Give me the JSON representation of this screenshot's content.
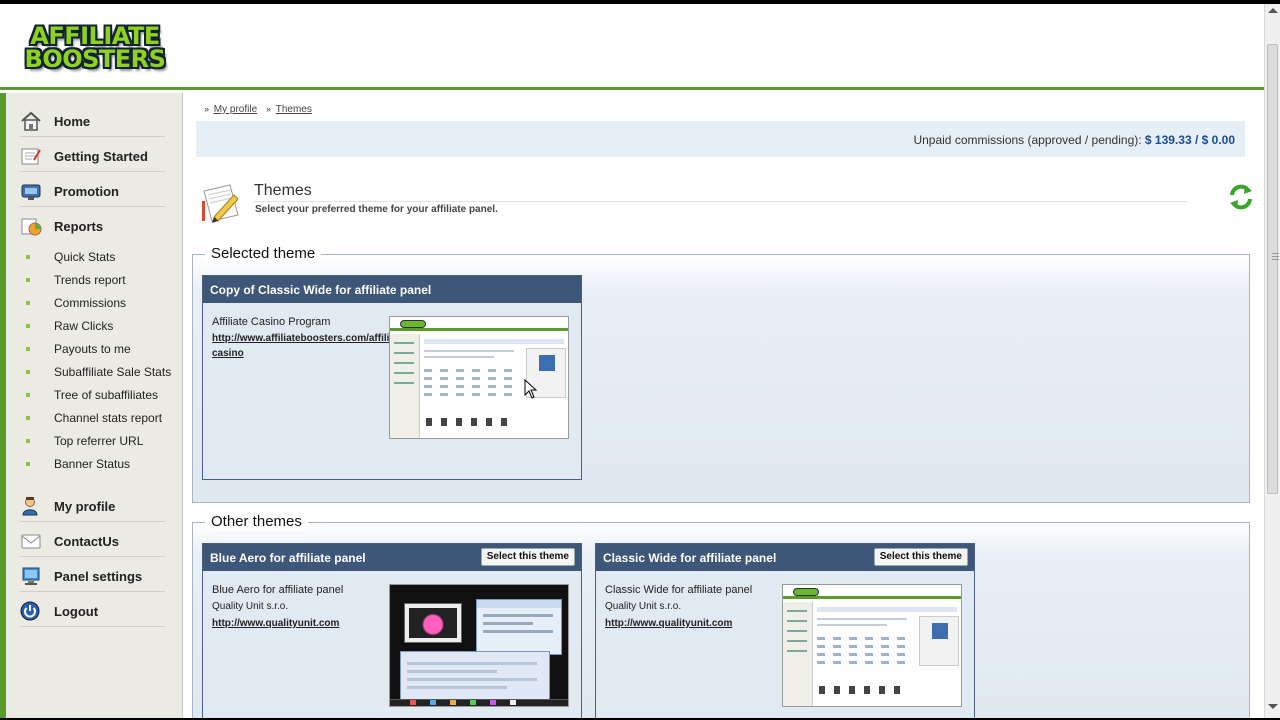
{
  "logo": {
    "line1": "AFFILIATE",
    "line2": "BOOSTERS"
  },
  "sidebar": {
    "main": [
      {
        "label": "Home",
        "icon": "home-icon"
      },
      {
        "label": "Getting Started",
        "icon": "getting-started-icon"
      },
      {
        "label": "Promotion",
        "icon": "promotion-icon"
      },
      {
        "label": "Reports",
        "icon": "reports-icon"
      }
    ],
    "reports_sub": [
      "Quick Stats",
      "Trends report",
      "Commissions",
      "Raw Clicks",
      "Payouts to me",
      "Subaffiliate Sale Stats",
      "Tree of subaffiliates",
      "Channel stats report",
      "Top referrer URL",
      "Banner Status"
    ],
    "bottom": [
      {
        "label": "My profile",
        "icon": "user-icon"
      },
      {
        "label": "ContactUs",
        "icon": "contact-icon"
      },
      {
        "label": "Panel settings",
        "icon": "monitor-icon"
      },
      {
        "label": "Logout",
        "icon": "power-icon"
      }
    ]
  },
  "breadcrumb": {
    "sep": "»",
    "items": [
      "My profile",
      "Themes"
    ]
  },
  "commissions": {
    "label": "Unpaid commissions (approved / pending):",
    "value": "$ 139.33 / $ 0.00"
  },
  "page": {
    "title": "Themes",
    "subtitle": "Select your preferred theme for your affiliate panel."
  },
  "selected_section": {
    "title": "Selected theme",
    "theme": {
      "name": "Copy of Classic Wide for affiliate panel",
      "description": "Affiliate Casino Program",
      "link_line1": "http://www.affiliateboosters.com/affiliate-",
      "link_line2": "casino"
    }
  },
  "other_section": {
    "title": "Other themes",
    "select_label": "Select this theme",
    "themes": [
      {
        "name": "Blue Aero for affiliate panel",
        "description": "Blue Aero for affiliate panel",
        "author": "Quality Unit s.r.o.",
        "link": "http://www.qualityunit.com"
      },
      {
        "name": "Classic Wide for affiliate panel",
        "description": "Classic Wide for affiliate panel",
        "author": "Quality Unit s.r.o.",
        "link": "http://www.qualityunit.com"
      }
    ]
  },
  "colors": {
    "brand_green": "#5b9a2d",
    "card_header": "#3e5678",
    "link_blue": "#1c4d94"
  }
}
